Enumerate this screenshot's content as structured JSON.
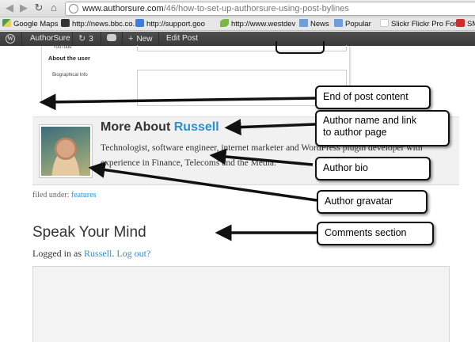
{
  "browser": {
    "url_host": "www.authorsure.com",
    "url_path": "/46/how-to-set-up-authorsure-using-post-bylines",
    "bookmarks": [
      {
        "label": "Google Maps",
        "icon": "maps-icon"
      },
      {
        "label": "http://news.bbc.co.",
        "icon": "bbc-icon"
      },
      {
        "label": "http://support.goo",
        "icon": "google-icon"
      },
      {
        "label": "http://www.westdev",
        "icon": "leaf-icon"
      },
      {
        "label": "News",
        "icon": "folder-icon"
      },
      {
        "label": "Popular",
        "icon": "folder-icon"
      },
      {
        "label": "Slickr Flickr Pro Foru",
        "icon": "flickr-icon"
      },
      {
        "label": "SMS",
        "icon": "sms-icon"
      }
    ]
  },
  "admin_bar": {
    "site_name": "AuthorSure",
    "updates_count": "3",
    "new_label": "New",
    "edit_label": "Edit Post"
  },
  "screenshot": {
    "youtube_label": "YouTube",
    "about_user": "About the user",
    "bio_label": "Biographical Info"
  },
  "author_box": {
    "heading_prefix": "More About",
    "author_name": "Russell",
    "bio": "Technologist, software engineer, internet marketer and WordPress plugin developer with experience in Finance, Telecoms and the Media."
  },
  "post_meta": {
    "filed_prefix": "filed under:",
    "category": "features"
  },
  "comments": {
    "heading": "Speak Your Mind",
    "logged_prefix": "Logged in as",
    "user": "Russell",
    "logout": "Log out?"
  },
  "annotations": {
    "end_of_post": "End of post content",
    "author_name_line1": "Author name and link",
    "author_name_line2": "to author page",
    "author_bio": "Author bio",
    "author_gravatar": "Author gravatar",
    "comments_section": "Comments section"
  },
  "colors": {
    "link": "#2e8fcf",
    "admin_bar": "#464646",
    "author_box_bg": "#f1f1f1"
  }
}
